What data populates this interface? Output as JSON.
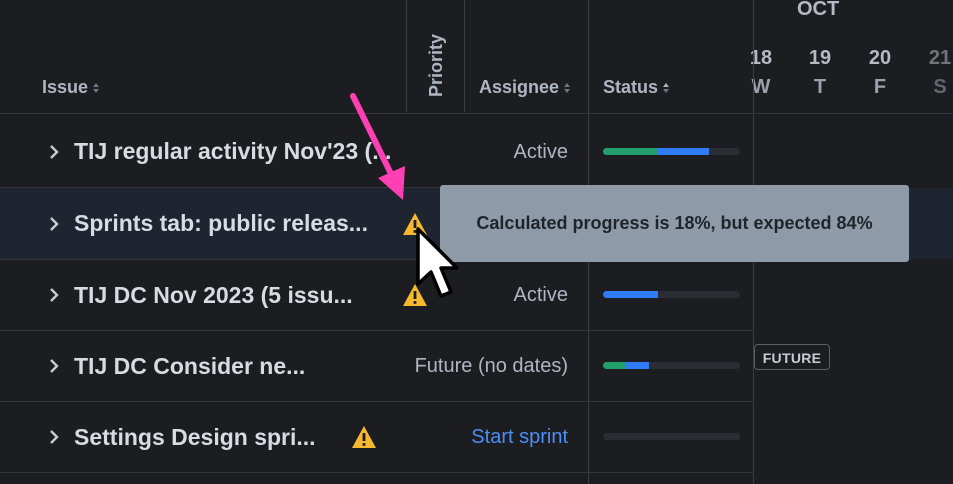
{
  "header": {
    "issue_label": "Issue",
    "priority_label": "Priority",
    "assignee_label": "Assignee",
    "status_label": "Status"
  },
  "calendar": {
    "month": "OCT",
    "days": [
      {
        "num": "18",
        "weekday": "W"
      },
      {
        "num": "19",
        "weekday": "T"
      },
      {
        "num": "20",
        "weekday": "F"
      },
      {
        "num": "21",
        "weekday": "S"
      }
    ]
  },
  "rows": [
    {
      "title": "TIJ regular activity Nov'23 (...",
      "state": "Active",
      "warning": false,
      "progress": {
        "green": 0.4,
        "blue": 0.38
      }
    },
    {
      "title": "Sprints tab: public releas...",
      "state": "",
      "warning": true,
      "progress": {
        "green": 0,
        "blue": 0
      }
    },
    {
      "title": "TIJ DC Nov 2023 (5 issu...",
      "state": "Active",
      "warning": true,
      "progress": {
        "green": 0,
        "blue": 0.4
      }
    },
    {
      "title": "TIJ DC Consider ne...",
      "state": "Future (no dates)",
      "warning": false,
      "progress": {
        "green": 0.16,
        "blue": 0.17
      }
    },
    {
      "title": "Settings Design spri...",
      "state": "Start sprint",
      "warning": true,
      "progress": {
        "green": 0,
        "blue": 0
      }
    }
  ],
  "future_badge": "FUTURE",
  "tooltip": "Calculated progress is 18%, but expected 84%",
  "colors": {
    "green": "#22a06b",
    "blue": "#2f7cf6",
    "warning": "#f5b82e",
    "annotation_arrow": "#ff3fb4"
  }
}
